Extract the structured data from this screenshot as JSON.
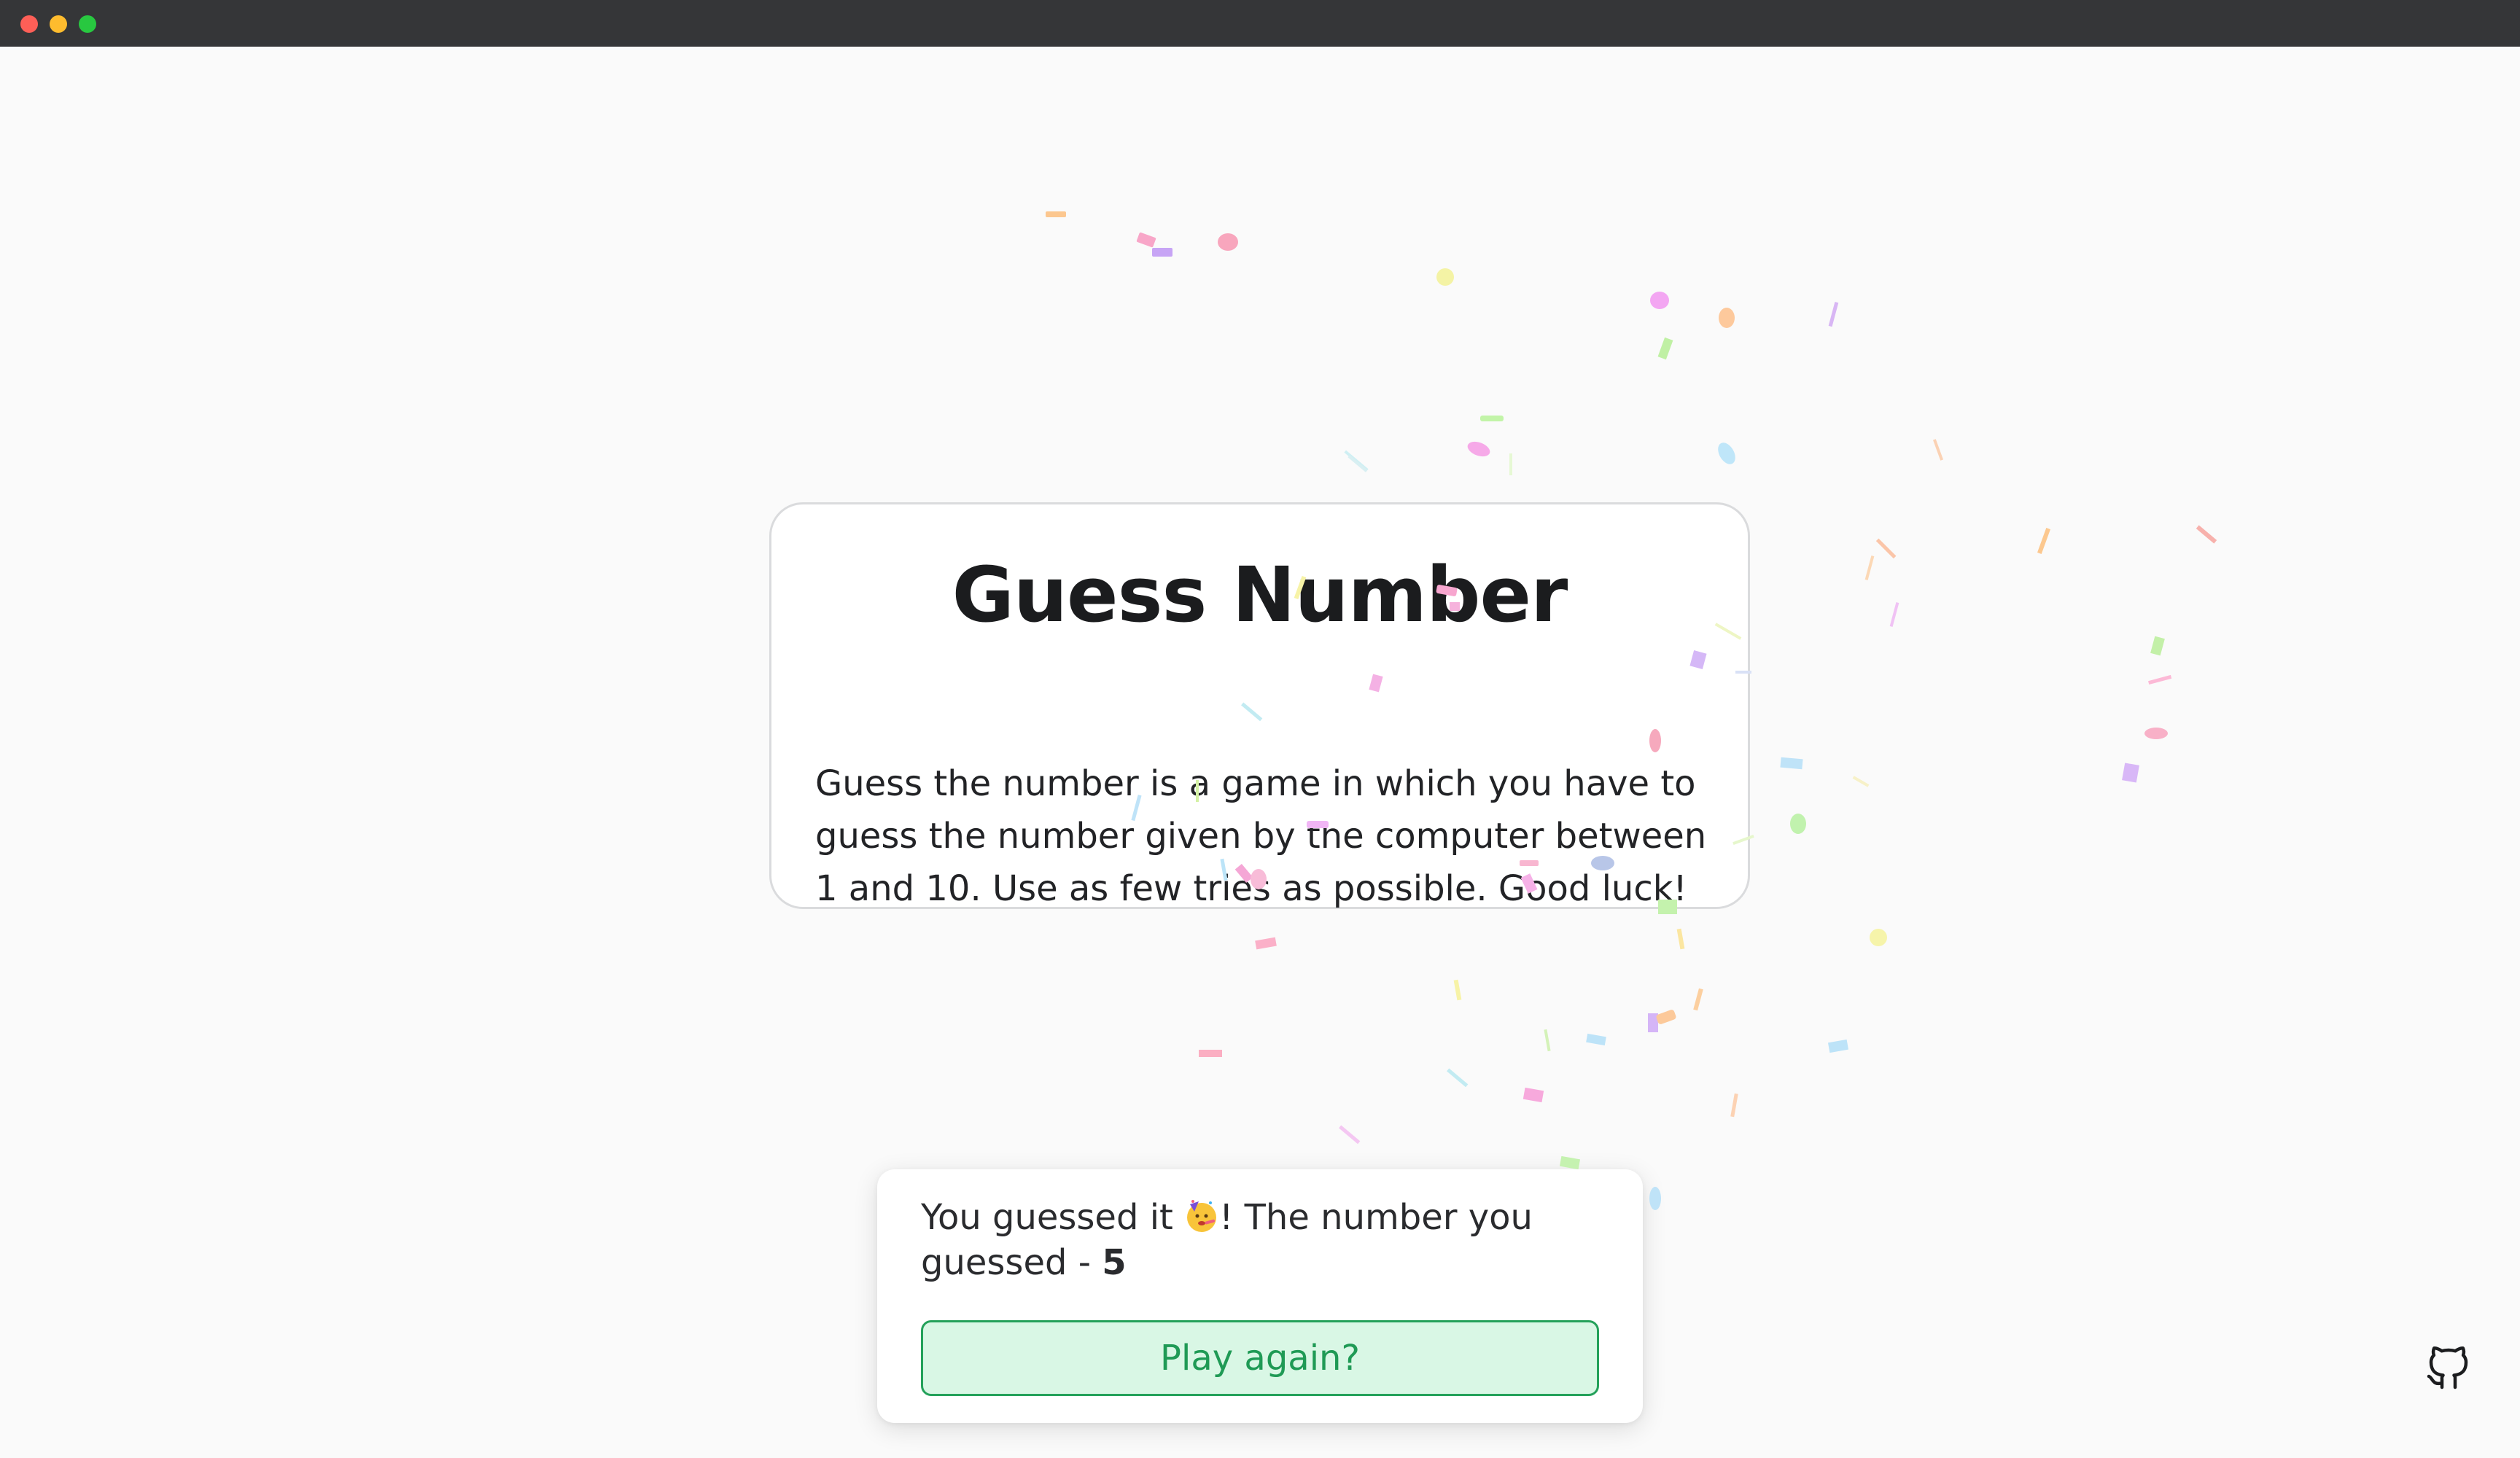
{
  "window": {
    "controls": [
      "close",
      "minimize",
      "maximize"
    ]
  },
  "card": {
    "title": "Guess Number",
    "description": "Guess the number is a game in which you have to guess the number given by the computer between 1 and 10. Use as few tries as possible. Good luck!"
  },
  "toast": {
    "message_prefix": "You guessed it",
    "emoji": "partying-face-emoji",
    "message_suffix": "! The number you guessed - ",
    "number": "5",
    "button_label": "Play again?"
  },
  "footer": {
    "icon": "github-icon"
  },
  "colors": {
    "background": "#fafafa",
    "titlebar": "#353638",
    "button_border": "#24a15a",
    "button_bg": "#d9f7e5",
    "button_text": "#1f9a55"
  }
}
